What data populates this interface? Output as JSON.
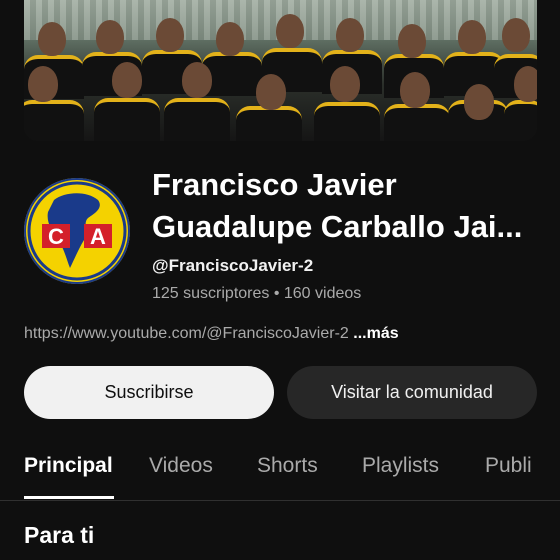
{
  "channel": {
    "name_line1": "Francisco Javier",
    "name_line2": "Guadalupe Carballo Jai...",
    "handle": "@FranciscoJavier-2",
    "stats": "125 suscriptores • 160 videos",
    "link": "https://www.youtube.com/@FranciscoJavier-2",
    "more": " ...más"
  },
  "avatar": {
    "icon": "club-america-crest-icon",
    "letters": "CA"
  },
  "buttons": {
    "subscribe": "Suscribirse",
    "community": "Visitar la comunidad"
  },
  "tabs": [
    "Principal",
    "Videos",
    "Shorts",
    "Playlists",
    "Publi"
  ],
  "active_tab": "Principal",
  "section_title": "Para ti",
  "colors": {
    "background": "#0f0f0f",
    "subscribe_bg": "#f1f1f1",
    "secondary_btn_bg": "#272727",
    "crest_yellow": "#f4d200",
    "crest_blue": "#1a3a8a",
    "crest_red": "#d4202a"
  }
}
